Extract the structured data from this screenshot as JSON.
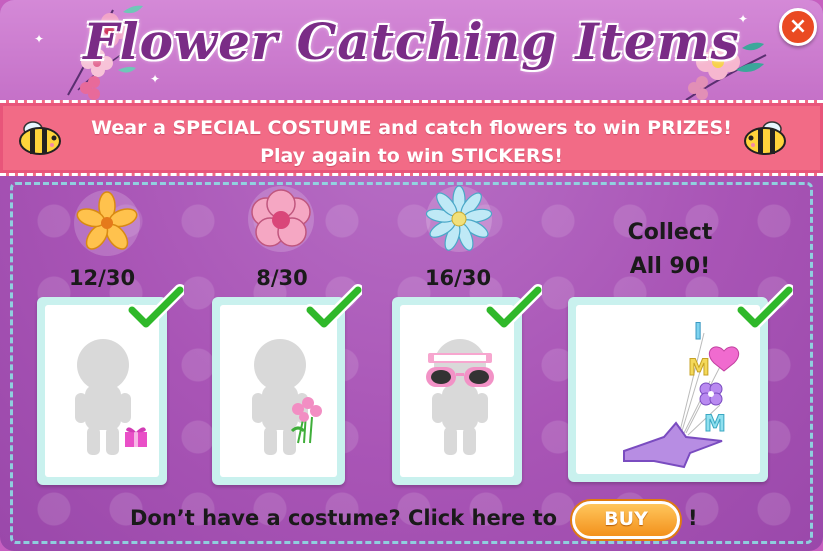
{
  "window": {
    "title": "Flower Catching Items",
    "close_label": "×"
  },
  "banner": {
    "line1": "Wear a SPECIAL COSTUME and catch flowers to win PRIZES!",
    "line2": "Play again to win STICKERS!"
  },
  "items": [
    {
      "flower": "orange-flower-icon",
      "count": "12/30",
      "prize": "gift-box-prize",
      "collected": true
    },
    {
      "flower": "pink-flower-icon",
      "count": "8/30",
      "prize": "flower-bouquet-prize",
      "collected": true
    },
    {
      "flower": "blue-flower-icon",
      "count": "16/30",
      "prize": "i-love-mom-sunglasses-prize",
      "collected": true
    }
  ],
  "grand_prize": {
    "line1": "Collect",
    "line2": "All 90!",
    "prize": "i-love-mom-balloons-prize",
    "collected": true
  },
  "footer": {
    "text": "Don’t have a costume? Click here to",
    "buy_label": "BUY",
    "suffix": "!"
  },
  "colors": {
    "background": "#a955b6",
    "banner": "#f26b86",
    "title": "#7a2c86",
    "close": "#ea4a22",
    "card": "#c9f1ee",
    "check": "#2fb82a",
    "buy": "#f3911c"
  }
}
